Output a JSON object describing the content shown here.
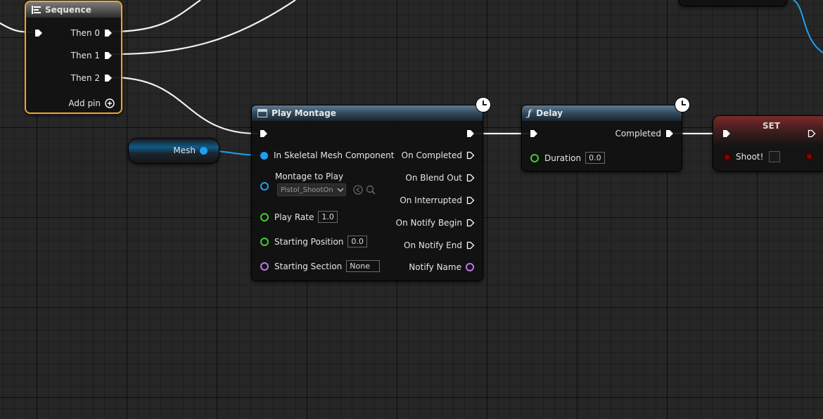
{
  "sequence": {
    "title": "Sequence",
    "pins": [
      "Then 0",
      "Then 1",
      "Then 2"
    ],
    "add_pin": "Add pin"
  },
  "mesh": {
    "label": "Mesh"
  },
  "play_montage": {
    "title": "Play Montage",
    "inputs": {
      "skeletal_mesh": "In Skeletal Mesh Component",
      "montage_to_play": "Montage to Play",
      "montage_value": "Pistol_ShootOn",
      "play_rate": "Play Rate",
      "play_rate_value": "1.0",
      "starting_position": "Starting Position",
      "starting_position_value": "0.0",
      "starting_section": "Starting Section",
      "starting_section_value": "None"
    },
    "outputs": [
      "On Completed",
      "On Blend Out",
      "On Interrupted",
      "On Notify Begin",
      "On Notify End",
      "Notify Name"
    ]
  },
  "delay": {
    "title": "Delay",
    "completed": "Completed",
    "duration_label": "Duration",
    "duration_value": "0.0"
  },
  "set": {
    "title": "SET",
    "variable": "Shoot!"
  },
  "colors": {
    "exec": "#ffffff",
    "object_pin": "#1ea0f0",
    "float_pin": "#3fd12f",
    "name_pin": "#c277e6",
    "bool_pin": "#8a0000",
    "selected_outline": "#f5a623"
  }
}
